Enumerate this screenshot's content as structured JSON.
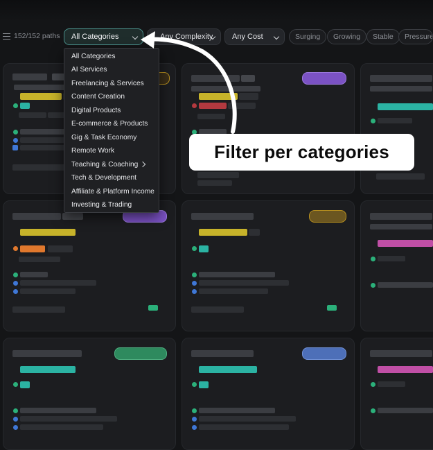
{
  "toolbar": {
    "paths_count": "152/152 paths",
    "category_select": "All Categories",
    "complexity_select": "Any Complexity",
    "cost_select": "Any Cost",
    "trend_chips": [
      "Surging",
      "Growing",
      "Stable",
      "Pressured"
    ]
  },
  "category_menu": {
    "items": [
      "All Categories",
      "AI Services",
      "Freelancing & Services",
      "Content Creation",
      "Digital Products",
      "E-commerce & Products",
      "Gig & Task Economy",
      "Remote Work",
      "Teaching & Coaching",
      "Tech & Development",
      "Affiliate & Platform Income",
      "Investing & Trading"
    ]
  },
  "callout": {
    "text": "Filter per categories"
  },
  "colors": {
    "accent_teal": "#4a8f8a",
    "tag_purple": "#7b52c4",
    "tag_gold": "#b8901f",
    "tag_green": "#2e8a5e",
    "tag_blue": "#4d6fb8",
    "bar_yellow": "#c7b32a",
    "bar_teal": "#2bb3a3",
    "bar_pink": "#c04fa6",
    "bar_orange": "#e0782d",
    "bar_red": "#b2393f"
  },
  "icons": {
    "filter": "sliders-icon",
    "dropdown": "chevron-down-icon",
    "submenu": "chevron-right-icon",
    "annotation": "curved-arrow-icon"
  }
}
